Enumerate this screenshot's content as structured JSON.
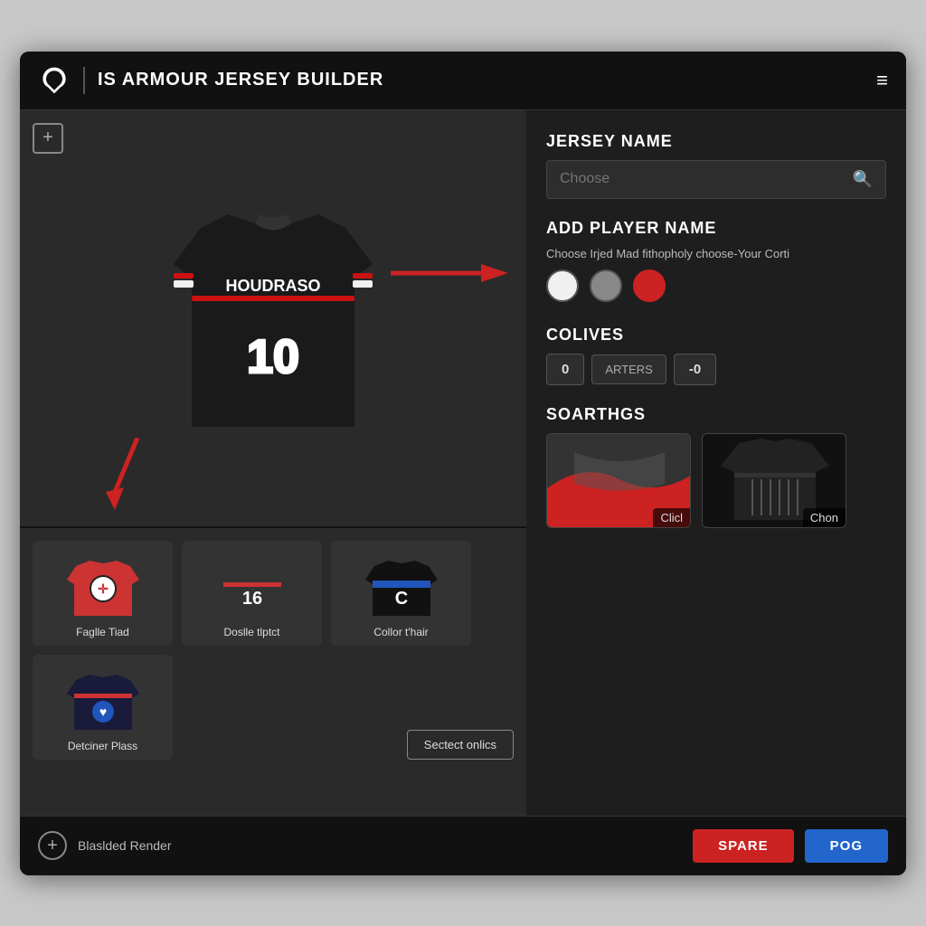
{
  "header": {
    "title": "IS ARMOUR JERSEY BUILDER",
    "menu_icon": "≡"
  },
  "jersey_preview": {
    "add_button_label": "+",
    "player_name": "HOUDRASO",
    "player_number": "10"
  },
  "jersey_name_section": {
    "title": "JERSEY NAME",
    "search_placeholder": "Choose",
    "search_icon": "🔍"
  },
  "add_player_name_section": {
    "title": "ADD PLAYER NAME",
    "subtitle": "Choose Irjed Mad fithopholy choose-Your Corti",
    "colors": [
      "white",
      "gray",
      "red"
    ]
  },
  "colives_section": {
    "title": "COLIVES",
    "value_left": "0",
    "label_middle": "ARTERS",
    "value_right": "-0"
  },
  "soarthgs_section": {
    "title": "SOARTHGS",
    "cards": [
      {
        "label": "Clicl",
        "bg_color": "#2a2a2a"
      },
      {
        "label": "Chon",
        "bg_color": "#1a1a1a"
      }
    ]
  },
  "jerseys_grid": {
    "items": [
      {
        "label": "Faglle Tiad",
        "number": "∅",
        "color": "red"
      },
      {
        "label": "Doslle tlptct",
        "number": "16",
        "color": "dark"
      },
      {
        "label": "Collor t'hair",
        "number": "C",
        "color": "blue"
      },
      {
        "label": "Detciner Plass",
        "number": "♥",
        "color": "blue2"
      }
    ],
    "select_button_label": "Sectect onlics"
  },
  "footer": {
    "add_button_label": "+",
    "label": "Blaslded Render",
    "spare_button": "SPARE",
    "pog_button": "POG"
  }
}
